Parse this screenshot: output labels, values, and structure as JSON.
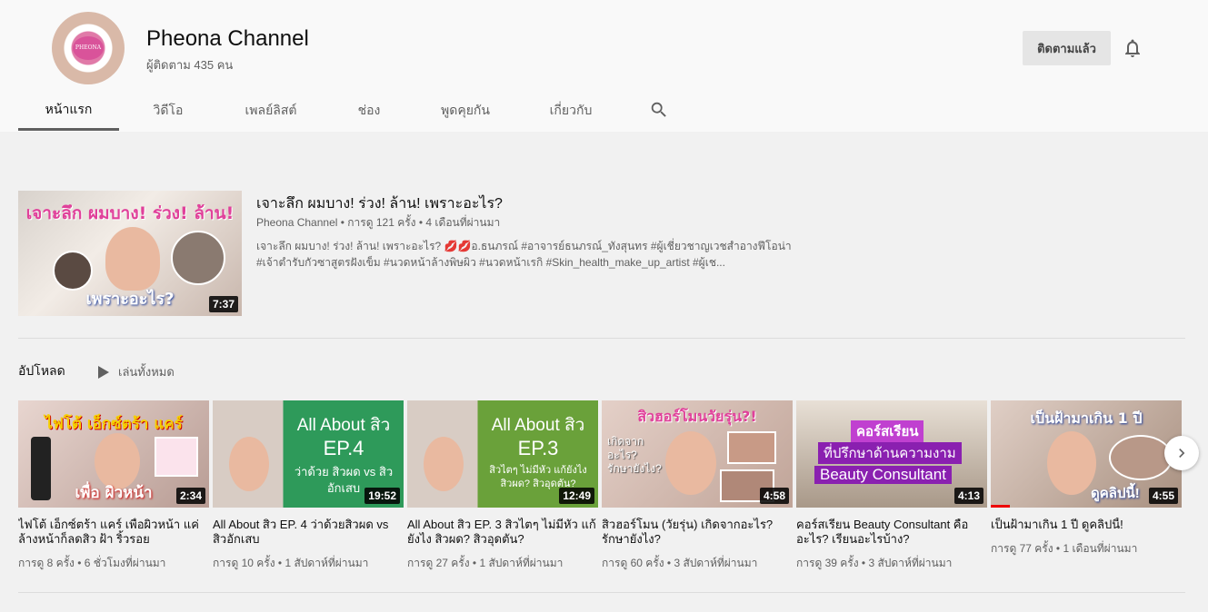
{
  "channel": {
    "name": "Pheona Channel",
    "subscribers": "ผู้ติดตาม 435 คน",
    "subscribed_label": "ติดตามแล้ว",
    "avatar_logo_text": "PHEONA"
  },
  "tabs": [
    {
      "label": "หน้าแรก",
      "active": true
    },
    {
      "label": "วิดีโอ",
      "active": false
    },
    {
      "label": "เพลย์ลิสต์",
      "active": false
    },
    {
      "label": "ช่อง",
      "active": false
    },
    {
      "label": "พูดคุยกัน",
      "active": false
    },
    {
      "label": "เกี่ยวกับ",
      "active": false
    }
  ],
  "featured": {
    "title": "เจาะลึก ผมบาง! ร่วง! ล้าน! เพราะอะไร?",
    "meta": "Pheona Channel • การดู 121 ครั้ง • 4 เดือนที่ผ่านมา",
    "description_line1": "เจาะลึก ผมบาง! ร่วง! ล้าน! เพราะอะไร? 💋💋อ.ธนภรณ์ #อาจารย์ธนภรณ์_ทังสุนทร #ผู้เชี่ยวชาญเวชสำอางฟีโอน่า",
    "description_line2": "#เจ้าตำรับกัวซาสูตรฝังเข็ม #นวดหน้าล้างพิษผิว #นวดหน้าเรกิ #Skin_health_make_up_artist #ผู้เช...",
    "duration": "7:37",
    "thumb_text_top": "เจาะลึก ผมบาง! ร่วง! ล้าน!",
    "thumb_text_bottom": "เพราะอะไร?"
  },
  "uploads": {
    "heading": "อัปโหลด",
    "play_all": "เล่นทั้งหมด",
    "videos": [
      {
        "title": "ไฟโต้ เอ็กซ์ตร้า แคร์ เพื่อผิวหน้า แค่ล้างหน้าก็ลดสิว ฝ้า ริ้วรอย",
        "meta": "การดู 8 ครั้ง • 6 ชั่วโมงที่ผ่านมา",
        "duration": "2:34",
        "thumb_top": "ไฟโต้ เอ็กซ์ตร้า แคร์",
        "thumb_bottom": "เพื่อ ผิวหน้า",
        "bg": "#c9b6ae",
        "progress": 0
      },
      {
        "title": "All About สิว EP. 4 ว่าด้วยสิวผด vs สิวอักเสบ",
        "meta": "การดู 10 ครั้ง • 1 สัปดาห์ที่ผ่านมา",
        "duration": "19:52",
        "thumb_top": "All About สิว",
        "thumb_mid": "EP.4",
        "thumb_bottom": "ว่าด้วย สิวผด vs สิวอักเสบ",
        "bg": "#2e9a5a",
        "progress": 0
      },
      {
        "title": "All About สิว EP. 3 สิวไตๆ ไม่มีหัว แก้ยังไง สิวผด? สิวอุดตัน?",
        "meta": "การดู 27 ครั้ง • 1 สัปดาห์ที่ผ่านมา",
        "duration": "12:49",
        "thumb_top": "All About สิว",
        "thumb_mid": "EP.3",
        "thumb_bottom": "สิวไตๆ ไม่มีหัว แก้ยังไง สิวผด? สิวอุดตัน?",
        "bg": "#6aa13a",
        "progress": 0
      },
      {
        "title": "สิวฮอร์โมน (วัยรุ่น) เกิดจากอะไร? รักษายังไง?",
        "meta": "การดู 60 ครั้ง • 3 สัปดาห์ที่ผ่านมา",
        "duration": "4:58",
        "thumb_top": "สิวฮอร์โมนวัยรุ่น?!",
        "thumb_bottom": "เกิดจากอะไร? รักษายังไง?",
        "bg": "#d8c0b8",
        "progress": 0
      },
      {
        "title": "คอร์สเรียน Beauty Consultant คืออะไร? เรียนอะไรบ้าง?",
        "meta": "การดู 39 ครั้ง • 3 สัปดาห์ที่ผ่านมา",
        "duration": "4:13",
        "thumb_top": "คอร์สเรียน",
        "thumb_mid": "ที่ปรึกษาด้านความงาม",
        "thumb_bottom": "Beauty Consultant",
        "bg": "#b8a898",
        "progress": 0
      },
      {
        "title": "เป็นฝ้ามาเกิน 1 ปี ดูคลิปนี้!",
        "meta": "การดู 77 ครั้ง • 1 เดือนที่ผ่านมา",
        "duration": "4:55",
        "thumb_top": "เป็นฝ้ามาเกิน 1 ปี",
        "thumb_bottom": "ดูคลิปนี้!",
        "bg": "#c0a89c",
        "progress": 0.1
      }
    ]
  },
  "colors": {
    "accent_red": "#ee0000",
    "pink": "#e0409a",
    "green": "#2e9a5a"
  }
}
